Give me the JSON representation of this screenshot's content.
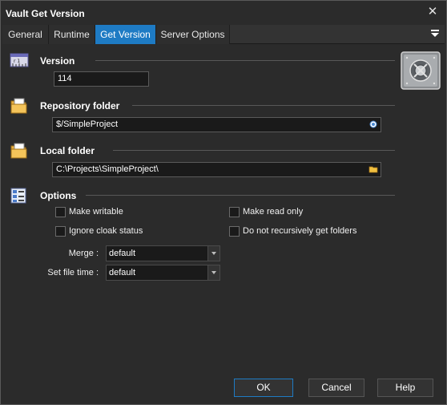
{
  "window": {
    "title": "Vault Get Version",
    "close_glyph": "✕"
  },
  "tabs": [
    {
      "label": "General",
      "active": false
    },
    {
      "label": "Runtime",
      "active": false
    },
    {
      "label": "Get Version",
      "active": true
    },
    {
      "label": "Server Options",
      "active": false
    }
  ],
  "sections": {
    "version": {
      "title": "Version",
      "icon": "ruler-icon",
      "value": "114"
    },
    "repository": {
      "title": "Repository folder",
      "icon": "folder-icon",
      "value": "$/SimpleProject",
      "browse_icon": "browse-icon"
    },
    "local": {
      "title": "Local folder",
      "icon": "folder-icon",
      "value": "C:\\Projects\\SimpleProject\\",
      "browse_icon": "open-folder-icon"
    },
    "options": {
      "title": "Options",
      "icon": "options-list-icon"
    }
  },
  "options": {
    "make_writable": {
      "label": "Make writable",
      "checked": false
    },
    "make_read_only": {
      "label": "Make read only",
      "checked": false
    },
    "ignore_cloak": {
      "label": "Ignore cloak status",
      "checked": false
    },
    "not_recursive": {
      "label": "Do not recursively get folders",
      "checked": false
    },
    "merge": {
      "label": "Merge :",
      "value": "default"
    },
    "set_file_time": {
      "label": "Set file time :",
      "value": "default"
    }
  },
  "buttons": {
    "ok": "OK",
    "cancel": "Cancel",
    "help": "Help"
  },
  "colors": {
    "accent": "#1e7bc4",
    "background": "#2b2b2b",
    "field_background": "#1a1a1a"
  }
}
